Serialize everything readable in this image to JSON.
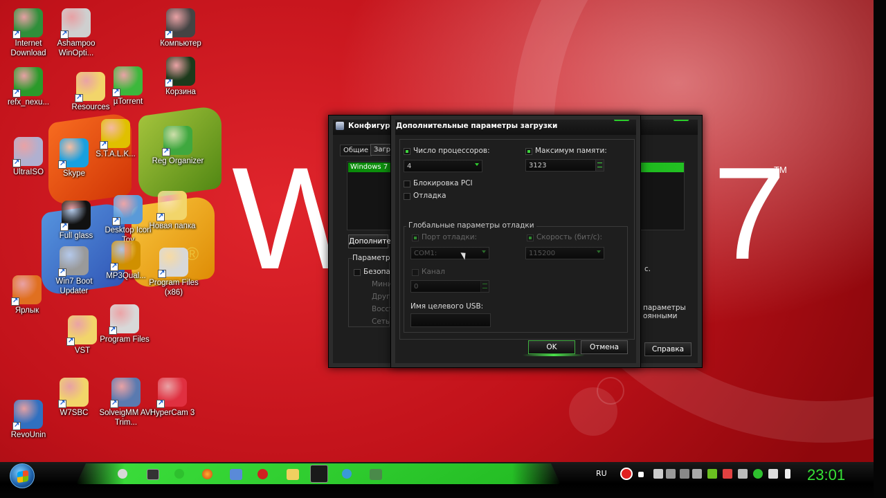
{
  "desktop_icons": [
    {
      "label": "Internet Download",
      "icon": "internet-download-manager-icon",
      "color": "#2f8f3a"
    },
    {
      "label": "Ashampoo WinOpti...",
      "icon": "gear-icon",
      "color": "#cfcfcf"
    },
    {
      "label": "Компьютер",
      "icon": "computer-icon",
      "color": "#444444"
    },
    {
      "label": "refx_nexu...",
      "icon": "utorrent-icon",
      "color": "#2a9a2a"
    },
    {
      "label": "Resources",
      "icon": "folder-icon",
      "color": "#f2d56a"
    },
    {
      "label": "µTorrent",
      "icon": "utorrent-icon",
      "color": "#3cb83c"
    },
    {
      "label": "Корзина",
      "icon": "recycle-bin-icon",
      "color": "#1c3a1c"
    },
    {
      "label": "S.T.A.L.K...",
      "icon": "radiation-icon",
      "color": "#e0c000"
    },
    {
      "label": "UltraISO",
      "icon": "disc-icon",
      "color": "#b0b0d0"
    },
    {
      "label": "Skype",
      "icon": "skype-icon",
      "color": "#18a0e0"
    },
    {
      "label": "Reg Organizer",
      "icon": "registry-icon",
      "color": "#3fa83f"
    },
    {
      "label": "Full glass",
      "icon": "glass-icon",
      "color": "#111111"
    },
    {
      "label": "Desktop Icon Toy",
      "icon": "toy-icon",
      "color": "#5a9ad8"
    },
    {
      "label": "Новая папка",
      "icon": "folder-icon",
      "color": "#f2d56a"
    },
    {
      "label": "Win7 Boot Updater",
      "icon": "boot-icon",
      "color": "#9a9a9a"
    },
    {
      "label": "MP3Qual...",
      "icon": "music-note-icon",
      "color": "#d09000"
    },
    {
      "label": "Program Files (x86)",
      "icon": "shield-icon",
      "color": "#d8d8d8"
    },
    {
      "label": "Ярлык",
      "icon": "firefox-icon",
      "color": "#e07020"
    },
    {
      "label": "VST",
      "icon": "folder-icon",
      "color": "#f2d56a"
    },
    {
      "label": "Program Files",
      "icon": "shield-icon",
      "color": "#d8d8d8"
    },
    {
      "label": "RevoUnin",
      "icon": "revo-uninstaller-icon",
      "color": "#3070c0"
    },
    {
      "label": "W7SBC",
      "icon": "folder-icon",
      "color": "#f2d56a"
    },
    {
      "label": "SolveigMM AVI Trim...",
      "icon": "film-icon",
      "color": "#5a7ab0"
    },
    {
      "label": "HyperCam 3",
      "icon": "hypercam-icon",
      "color": "#e03040"
    }
  ],
  "wallpaper": {
    "text_w": "W",
    "text_7": "7",
    "tm": "TM",
    "registered": "®"
  },
  "msconfig": {
    "title": "Конфигурац",
    "tabs": [
      "Общие",
      "Загр"
    ],
    "os_entry": "Windows 7 (",
    "advanced_button": "Дополнитe",
    "params_label": "Параметры",
    "safe_label": "Безопас",
    "radios": [
      "Мини",
      "Друг",
      "Восст",
      "Сеть"
    ],
    "right_text_1": "с.",
    "right_text_2": "параметры",
    "right_text_3": "оянными",
    "help_button": "Справка"
  },
  "dialog": {
    "title": "Дополнительные параметры загрузки",
    "cpu_label": "Число процессоров:",
    "cpu_value": "4",
    "mem_label": "Максимум памяти:",
    "mem_value": "3123",
    "pci_label": "Блокировка PCI",
    "debug_label": "Отладка",
    "global_debug_title": "Глобальные параметры отладки",
    "debug_port_label": "Порт отладки:",
    "debug_port_value": "COM1:",
    "speed_label": "Скорость (бит/с):",
    "speed_value": "115200",
    "channel_label": "Канал",
    "channel_value": "0",
    "usb_label": "Имя целевого USB:",
    "usb_value": "",
    "ok": "OK",
    "cancel": "Отмена"
  },
  "taskbar": {
    "language": "RU",
    "clock": "23:01"
  },
  "colors": {
    "accent_green": "#36e236",
    "wallpaper_red": "#c1121a"
  }
}
